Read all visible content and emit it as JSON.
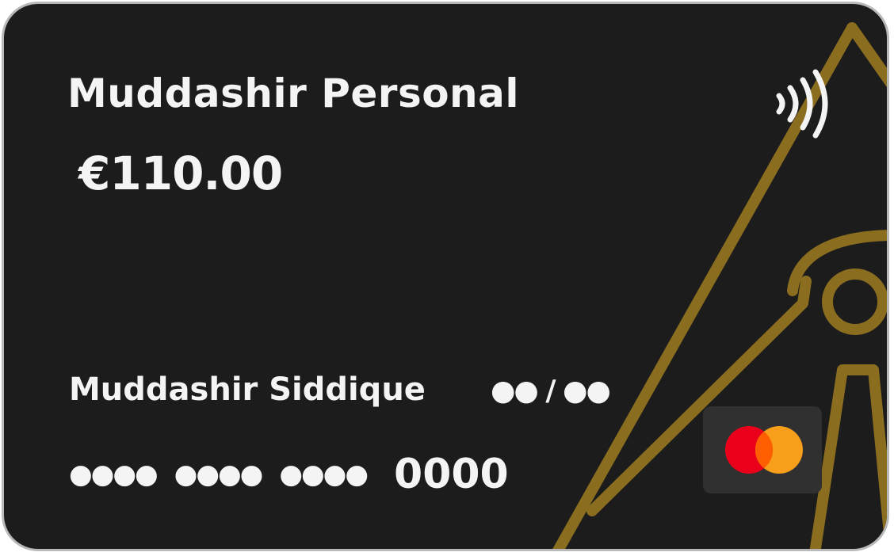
{
  "card": {
    "account_name": "Muddashir Personal",
    "balance": "€110.00",
    "holder_name": "Muddashir Siddique",
    "expiry": "●● / ●●",
    "number_groups": [
      "●●●●",
      "●●●●",
      "●●●●"
    ],
    "last_four": "0000"
  },
  "icons": {
    "contactless": "contactless-icon",
    "network": "mastercard-logo"
  },
  "colors": {
    "card_background": "#1c1c1c",
    "decoration_gold": "#8a6d1f",
    "mastercard_red": "#eb001b",
    "mastercard_orange": "#f79e1b"
  }
}
